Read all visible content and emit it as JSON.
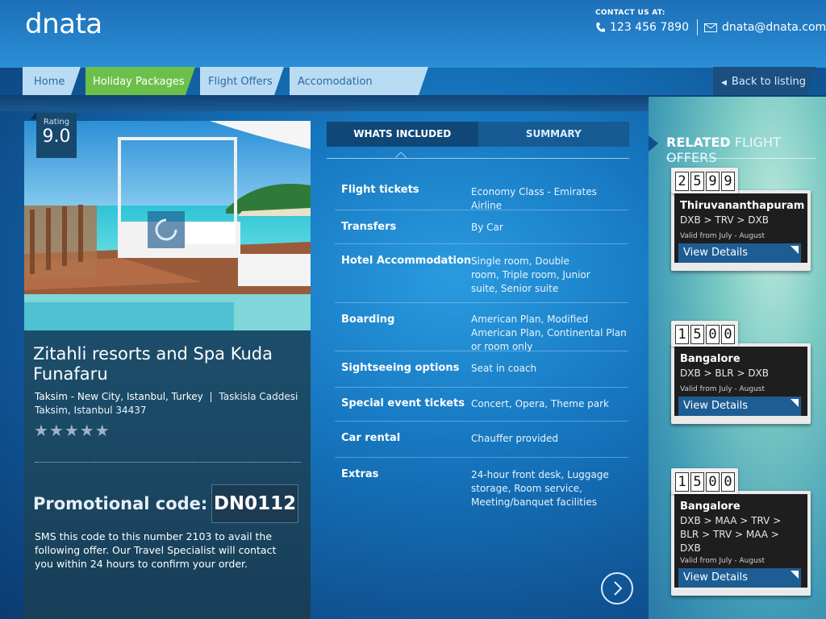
{
  "header": {
    "logo": "dnata",
    "contact_label": "CONTACT  US AT:",
    "phone": "123 456 7890",
    "email": "dnata@dnata.com"
  },
  "nav": {
    "tabs": [
      {
        "label": "Home"
      },
      {
        "label": "Holiday Packages",
        "active": true
      },
      {
        "label": "Flight Offers"
      },
      {
        "label": "Accomodation Packages"
      }
    ],
    "back_label": "Back to listing"
  },
  "hotel": {
    "rating_label": "Rating",
    "rating_value": "9.0",
    "name": "Zitahli resorts and Spa Kuda Funafaru",
    "address_line1_bold": "Taksim - New City, Istanbul, Turkey",
    "address_separator": "|",
    "address_line1_rest": "Taskisla Caddesi",
    "address_line2": "Taksim, Istanbul 34437",
    "stars": "★★★★★",
    "star_rating": 0,
    "promo_label": "Promotional code:",
    "promo_code": "DN0112",
    "sms_text": "SMS this code to this number 2103 to avail the following offer. Our Travel Specialist will contact you within 24 hours to confirm your order."
  },
  "details": {
    "tab_included": "WHATS INCLUDED",
    "tab_summary": "SUMMARY",
    "rows": [
      {
        "key": "Flight tickets",
        "value": "Economy Class - Emirates Airline"
      },
      {
        "key": "Transfers",
        "value": "By Car"
      },
      {
        "key": "Hotel Accommodation",
        "value": "Single room, Double room, Triple room, Junior suite, Senior suite"
      },
      {
        "key": "Boarding",
        "value": "American Plan, Modified American Plan, Continental Plan or room only"
      },
      {
        "key": "Sightseeing options",
        "value": "Seat in coach"
      },
      {
        "key": "Special event tickets",
        "value": "Concert, Opera, Theme park"
      },
      {
        "key": "Car rental",
        "value": "Chauffer provided"
      },
      {
        "key": "Extras",
        "value": "24-hour front desk, Luggage storage, Room service, Meeting/banquet facilities"
      }
    ]
  },
  "related": {
    "title_bold": "RELATED",
    "title_rest": " FLIGHT OFFERS",
    "offers": [
      {
        "price_digits": [
          "2",
          "5",
          "9",
          "9"
        ],
        "city": "Thiruvananthapuram",
        "route": "DXB > TRV > DXB",
        "valid": "Valid from July - August",
        "cta": "View Details"
      },
      {
        "price_digits": [
          "1",
          "5",
          "0",
          "0"
        ],
        "city": "Bangalore",
        "route": "DXB > BLR >  DXB",
        "valid": "Valid from July - August",
        "cta": "View Details"
      },
      {
        "price_digits": [
          "1",
          "5",
          "0",
          "0"
        ],
        "city": "Bangalore",
        "route": "DXB > MAA > TRV > BLR > TRV > MAA > DXB",
        "valid": "Valid from July - August",
        "cta": "View Details"
      }
    ]
  },
  "colors": {
    "active_tab": "#6cc04a",
    "tab_inactive": "#b9dcf3",
    "view_details": "#1d5d94"
  }
}
